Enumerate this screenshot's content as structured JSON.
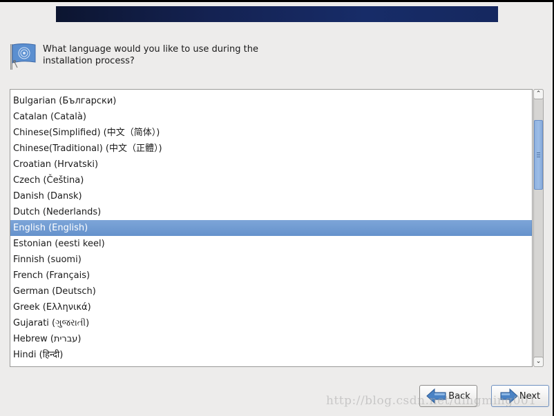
{
  "header": {
    "question": "What language would you like to use during the installation process?"
  },
  "language_list": {
    "selected_index": 8,
    "items": [
      "Bulgarian (Български)",
      "Catalan (Català)",
      "Chinese(Simplified) (中文（简体）)",
      "Chinese(Traditional) (中文（正體）)",
      "Croatian (Hrvatski)",
      "Czech (Čeština)",
      "Danish (Dansk)",
      "Dutch (Nederlands)",
      "English (English)",
      "Estonian (eesti keel)",
      "Finnish (suomi)",
      "French (Français)",
      "German (Deutsch)",
      "Greek (Ελληνικά)",
      "Gujarati (ગુજરાતી)",
      "Hebrew (עברית)",
      "Hindi (हिन्दी)"
    ]
  },
  "scrollbar": {
    "up_glyph": "⌃",
    "down_glyph": "⌄"
  },
  "buttons": {
    "back_label": "Back",
    "next_label": "Next"
  },
  "colors": {
    "selection": "#6f9ad2",
    "banner": "#15285f"
  },
  "watermark": "http://blog.csdn.net/dingming001"
}
